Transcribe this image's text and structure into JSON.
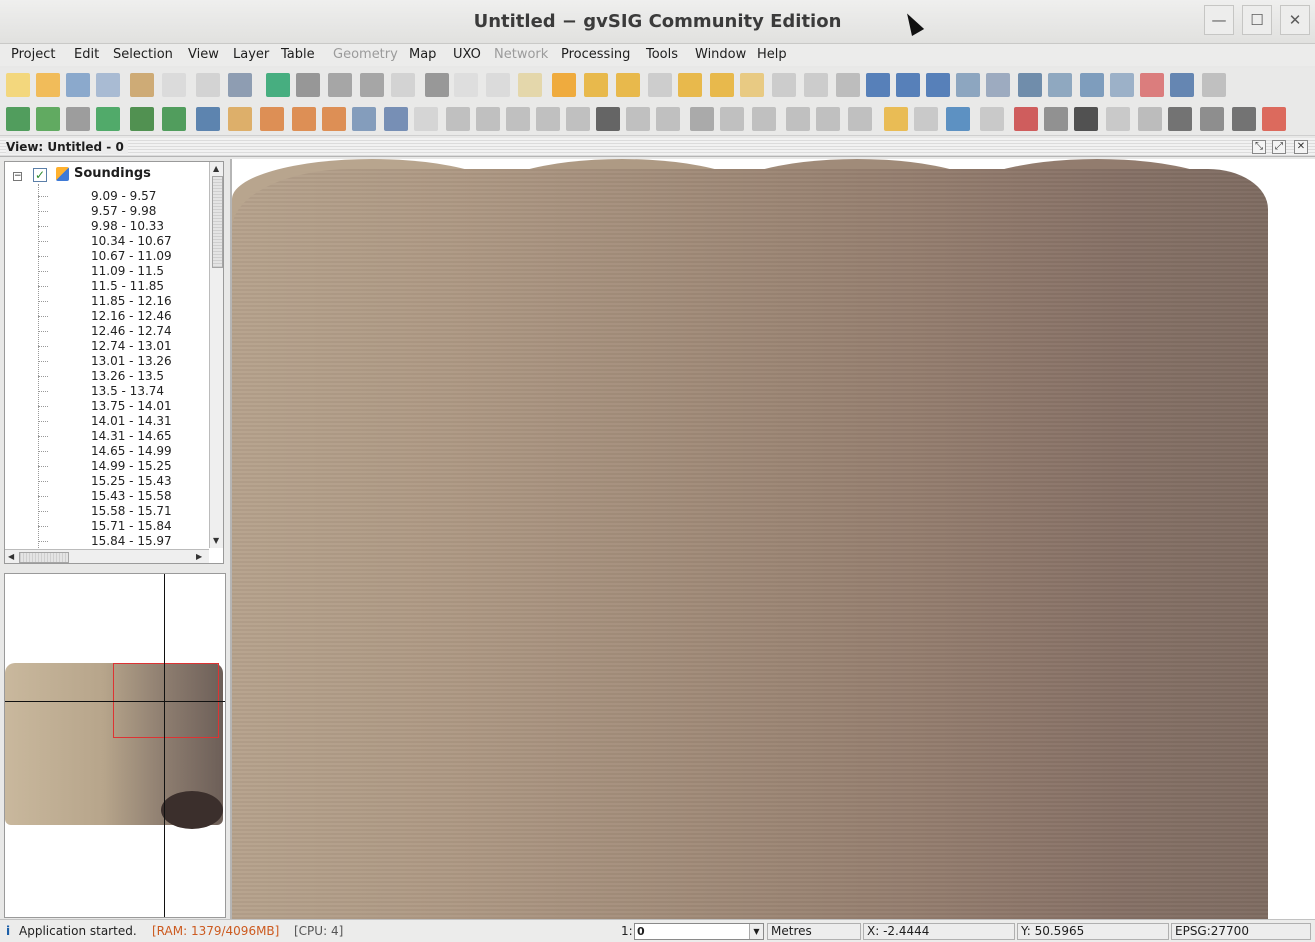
{
  "window": {
    "title": "Untitled − gvSIG Community Edition",
    "minimize_label": "—",
    "maximize_label": "☐",
    "close_label": "✕"
  },
  "menubar": {
    "items": [
      {
        "label": "Project",
        "enabled": true
      },
      {
        "label": "Edit",
        "enabled": true
      },
      {
        "label": "Selection",
        "enabled": true
      },
      {
        "label": "View",
        "enabled": true
      },
      {
        "label": "Layer",
        "enabled": true
      },
      {
        "label": "Table",
        "enabled": true
      },
      {
        "label": "Geometry",
        "enabled": false
      },
      {
        "label": "Map",
        "enabled": true
      },
      {
        "label": "UXO",
        "enabled": true
      },
      {
        "label": "Network",
        "enabled": false
      },
      {
        "label": "Processing",
        "enabled": true
      },
      {
        "label": "Tools",
        "enabled": true
      },
      {
        "label": "Window",
        "enabled": true
      },
      {
        "label": "Help",
        "enabled": true
      }
    ]
  },
  "view": {
    "title": "View: Untitled - 0"
  },
  "toc": {
    "layer_name": "Soundings",
    "layer_checked": true,
    "legend": [
      "9.09 - 9.57",
      "9.57 - 9.98",
      "9.98 - 10.33",
      "10.34 - 10.67",
      "10.67 - 11.09",
      "11.09 - 11.5",
      "11.5 - 11.85",
      "11.85 - 12.16",
      "12.16 - 12.46",
      "12.46 - 12.74",
      "12.74 - 13.01",
      "13.01 - 13.26",
      "13.26 - 13.5",
      "13.5 - 13.74",
      "13.75 - 14.01",
      "14.01 - 14.31",
      "14.31 - 14.65",
      "14.65 - 14.99",
      "14.99 - 15.25",
      "15.25 - 15.43",
      "15.43 - 15.58",
      "15.58 - 15.71",
      "15.71 - 15.84",
      "15.84 - 15.97"
    ]
  },
  "statusbar": {
    "info_icon": "i",
    "message": "Application started.",
    "ram": "[RAM: 1379/4096MB]",
    "cpu": "[CPU: 4]",
    "scale_prefix": "1:",
    "scale_value": "0",
    "units": "Metres",
    "x": "X: -2.4444",
    "y": "Y: 50.5965",
    "crs": "EPSG:27700"
  },
  "colors": {
    "ram_text": "#cc5a1f",
    "overview_extent": "#d33333"
  }
}
